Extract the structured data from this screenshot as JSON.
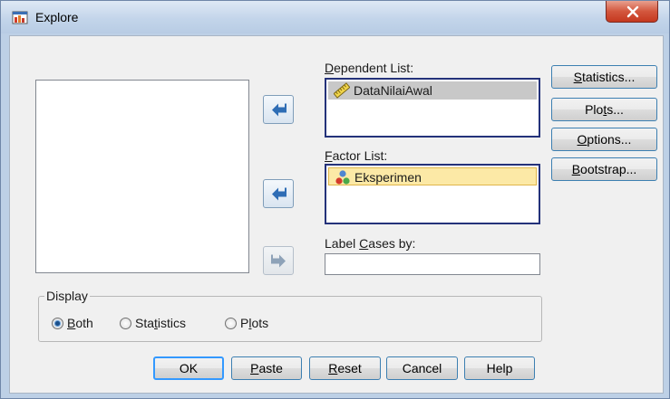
{
  "window": {
    "title": "Explore"
  },
  "lists": {
    "dependent_label_pre": "",
    "dependent_label_u": "D",
    "dependent_label_post": "ependent List:",
    "dependent_items": [
      "DataNilaiAwal"
    ],
    "factor_label_u": "F",
    "factor_label_post": "actor List:",
    "factor_items": [
      "Eksperimen"
    ],
    "label_cases_pre": "Label ",
    "label_cases_u": "C",
    "label_cases_post": "ases by:"
  },
  "side_buttons": [
    {
      "pre": "",
      "u": "S",
      "post": "tatistics..."
    },
    {
      "pre": "Plo",
      "u": "t",
      "post": "s..."
    },
    {
      "pre": "",
      "u": "O",
      "post": "ptions..."
    },
    {
      "pre": "",
      "u": "B",
      "post": "ootstrap..."
    }
  ],
  "display": {
    "legend": "Display",
    "options": [
      {
        "pre": "",
        "u": "B",
        "post": "oth",
        "selected": true
      },
      {
        "pre": "Sta",
        "u": "t",
        "post": "istics",
        "selected": false
      },
      {
        "pre": "P",
        "u": "l",
        "post": "ots",
        "selected": false
      }
    ]
  },
  "buttons": {
    "ok": "OK",
    "paste_u": "P",
    "paste_post": "aste",
    "reset_u": "R",
    "reset_post": "eset",
    "cancel": "Cancel",
    "help": "Help"
  },
  "colors": {
    "accent_arrow": "#2e6db5",
    "selection_gray": "#c8c8c8",
    "selection_yellow": "#fce9a6"
  }
}
